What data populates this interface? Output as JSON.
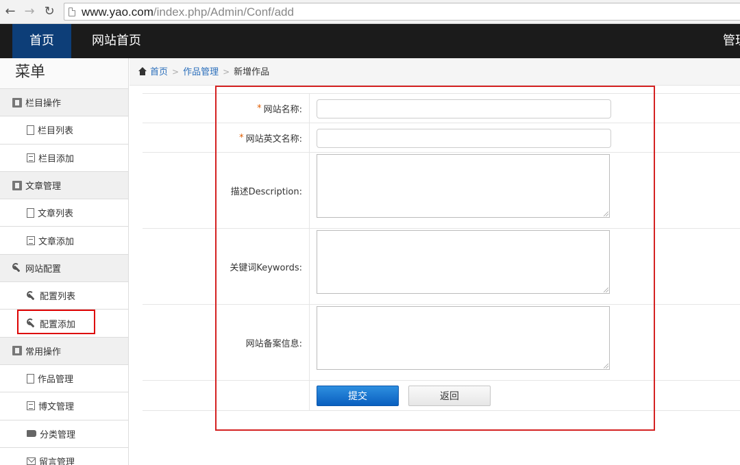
{
  "browser": {
    "url_host": "www.yao.com",
    "url_path": "/index.php/Admin/Conf/add",
    "back_glyph": "←",
    "forward_glyph": "→",
    "reload_glyph": "↻"
  },
  "topnav": {
    "home": "首页",
    "site_home": "网站首页",
    "manage": "管理"
  },
  "sidebar": {
    "title": "菜单",
    "groups": [
      {
        "label": "栏目操作",
        "icon": "book-icon",
        "items": [
          {
            "label": "栏目列表",
            "icon": "file-icon"
          },
          {
            "label": "栏目添加",
            "icon": "list-icon"
          }
        ]
      },
      {
        "label": "文章管理",
        "icon": "book-icon",
        "items": [
          {
            "label": "文章列表",
            "icon": "file-icon"
          },
          {
            "label": "文章添加",
            "icon": "list-icon"
          }
        ]
      },
      {
        "label": "网站配置",
        "icon": "wrench-icon",
        "items": [
          {
            "label": "配置列表",
            "icon": "wrench-icon"
          },
          {
            "label": "配置添加",
            "icon": "wrench-icon",
            "selected": true
          }
        ]
      },
      {
        "label": "常用操作",
        "icon": "book-icon",
        "items": [
          {
            "label": "作品管理",
            "icon": "file-icon"
          },
          {
            "label": "博文管理",
            "icon": "list-icon"
          },
          {
            "label": "分类管理",
            "icon": "tags-icon"
          },
          {
            "label": "留言管理",
            "icon": "mail-icon"
          }
        ]
      }
    ]
  },
  "breadcrumb": {
    "home": "首页",
    "section": "作品管理",
    "current": "新增作品",
    "separator": ">"
  },
  "form": {
    "required_mark": "*",
    "fields": {
      "site_name": {
        "label": "网站名称:",
        "value": ""
      },
      "site_english_name": {
        "label": "网站英文名称:",
        "value": ""
      },
      "description": {
        "label": "描述Description:",
        "value": ""
      },
      "keywords": {
        "label": "关键词Keywords:",
        "value": ""
      },
      "icp_info": {
        "label": "网站备案信息:",
        "value": ""
      }
    },
    "submit_label": "提交",
    "back_label": "返回"
  },
  "colors": {
    "topnav_bg": "#1b1b1b",
    "topnav_active": "#0d3e78",
    "link": "#2a6ebb",
    "annotation_red": "#d42020",
    "submit_blue": "#0a5fbf"
  }
}
